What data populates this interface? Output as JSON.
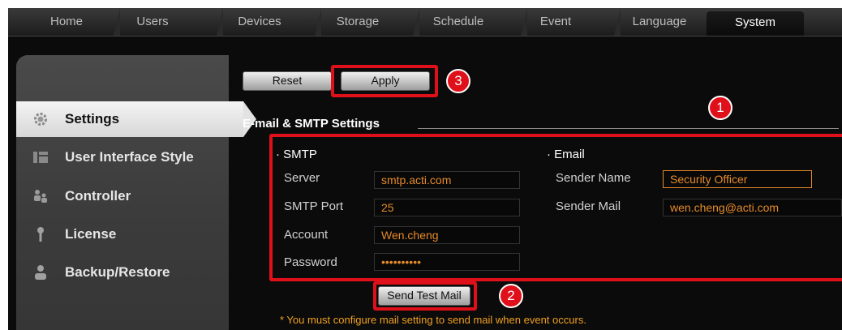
{
  "tabs": [
    {
      "label": "Home"
    },
    {
      "label": "Users"
    },
    {
      "label": "Devices"
    },
    {
      "label": "Storage"
    },
    {
      "label": "Schedule"
    },
    {
      "label": "Event"
    },
    {
      "label": "Language"
    },
    {
      "label": "System"
    }
  ],
  "active_tab": "System",
  "sidebar": {
    "items": [
      {
        "label": "Settings",
        "icon": "gear-icon"
      },
      {
        "label": "User Interface Style",
        "icon": "layout-icon"
      },
      {
        "label": "Controller",
        "icon": "users-icon"
      },
      {
        "label": "License",
        "icon": "key-icon"
      },
      {
        "label": "Backup/Restore",
        "icon": "user-icon"
      }
    ]
  },
  "toolbar": {
    "reset_label": "Reset",
    "apply_label": "Apply"
  },
  "section_title": "E-mail & SMTP Settings",
  "smtp": {
    "title": "· SMTP",
    "server_label": "Server",
    "server_value": "smtp.acti.com",
    "port_label": "SMTP Port",
    "port_value": "25",
    "account_label": "Account",
    "account_value": "Wen.cheng",
    "password_label": "Password",
    "password_value": "••••••••••"
  },
  "email": {
    "title": "· Email",
    "sender_name_label": "Sender Name",
    "sender_name_value": "Security Officer",
    "sender_mail_label": "Sender Mail",
    "sender_mail_value": "wen.cheng@acti.com"
  },
  "send_test_label": "Send Test Mail",
  "notice": "* You must configure mail setting to send mail when event occurs.",
  "badges": [
    "1",
    "2",
    "3"
  ],
  "colors": {
    "annotation_red": "#e0101a",
    "field_text": "#e58a2a",
    "notice": "#f0a020"
  }
}
